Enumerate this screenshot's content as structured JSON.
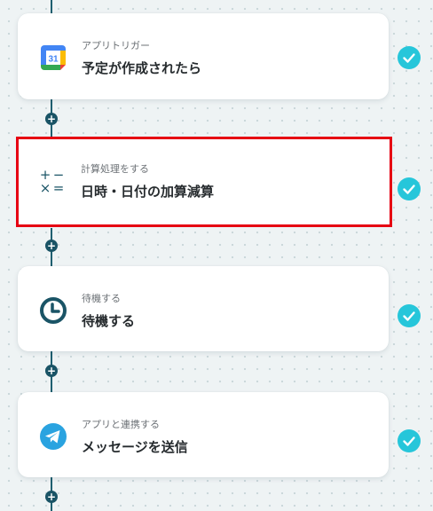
{
  "steps": [
    {
      "label": "アプリトリガー",
      "title": "予定が作成されたら",
      "icon": "google-calendar-icon",
      "calendar_day": "31",
      "selected": false,
      "done": true
    },
    {
      "label": "計算処理をする",
      "title": "日時・日付の加算減算",
      "icon": "calculator-operators-icon",
      "operators": [
        "+",
        "−",
        "×",
        "="
      ],
      "selected": true,
      "done": true
    },
    {
      "label": "待機する",
      "title": "待機する",
      "icon": "clock-icon",
      "selected": false,
      "done": true
    },
    {
      "label": "アプリと連携する",
      "title": "メッセージを送信",
      "icon": "telegram-icon",
      "selected": false,
      "done": true
    }
  ],
  "connector_plus": "+",
  "colors": {
    "connector": "#1f5f70",
    "check": "#26c6da",
    "selection_border": "#e60012",
    "teal_icon": "#1a5466",
    "telegram": "#2aa3e0"
  }
}
